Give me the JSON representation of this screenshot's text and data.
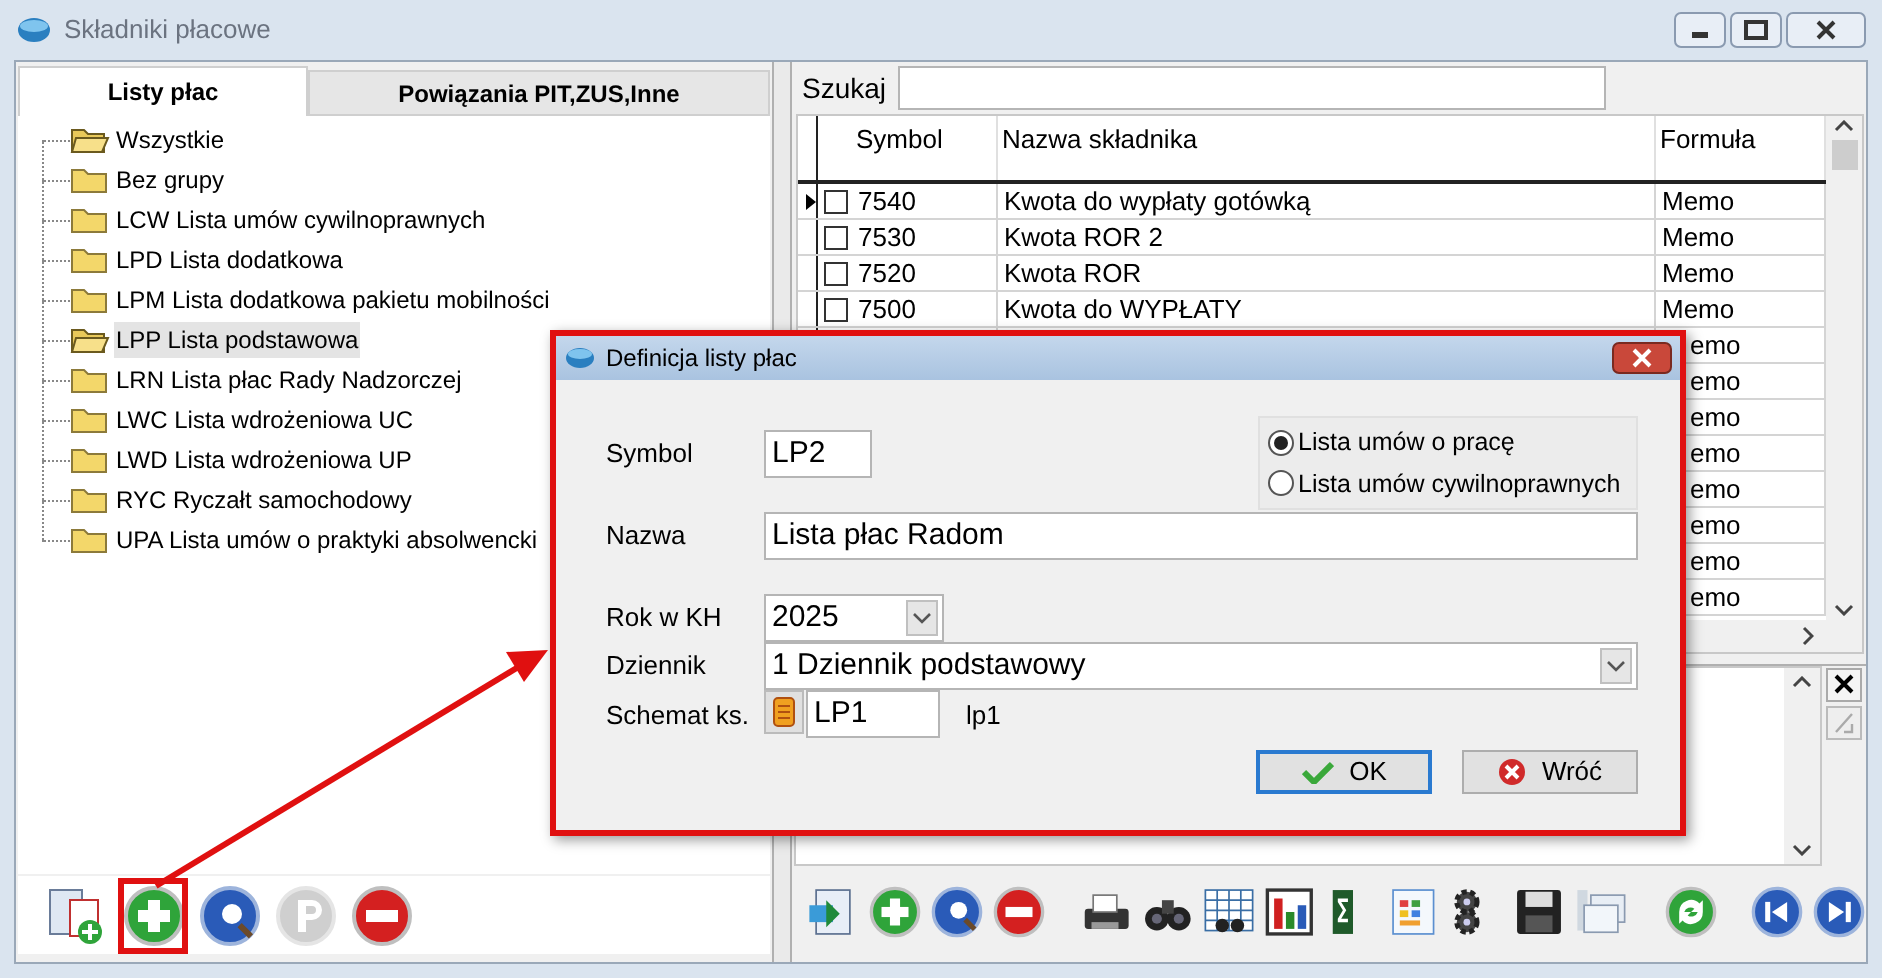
{
  "window": {
    "title": "Składniki płacowe"
  },
  "tabs": [
    {
      "label": "Listy płac",
      "selected": true
    },
    {
      "label": "Powiązania PIT,ZUS,Inne",
      "selected": false
    }
  ],
  "tree": {
    "items": [
      {
        "label": "Wszystkie",
        "open": true,
        "selected": false
      },
      {
        "label": "Bez grupy",
        "open": false,
        "selected": false
      },
      {
        "label": "LCW Lista umów cywilnoprawnych",
        "open": false,
        "selected": false
      },
      {
        "label": "LPD Lista dodatkowa",
        "open": false,
        "selected": false
      },
      {
        "label": "LPM Lista dodatkowa pakietu mobilności",
        "open": false,
        "selected": false
      },
      {
        "label": "LPP Lista podstawowa",
        "open": true,
        "selected": true
      },
      {
        "label": "LRN Lista płac Rady Nadzorczej",
        "open": false,
        "selected": false
      },
      {
        "label": "LWC Lista wdrożeniowa UC",
        "open": false,
        "selected": false
      },
      {
        "label": "LWD Lista wdrożeniowa UP",
        "open": false,
        "selected": false
      },
      {
        "label": "RYC Ryczałt samochodowy",
        "open": false,
        "selected": false
      },
      {
        "label": "UPA Lista umów o praktyki absolwencki",
        "open": false,
        "selected": false
      }
    ]
  },
  "left_toolbar": [
    {
      "kind": "add-list",
      "highlighted": false
    },
    {
      "kind": "add",
      "highlighted": true
    },
    {
      "kind": "preview",
      "highlighted": false
    },
    {
      "kind": "p",
      "highlighted": false
    },
    {
      "kind": "remove",
      "highlighted": false
    }
  ],
  "search": {
    "label": "Szukaj"
  },
  "grid": {
    "columns": [
      "Symbol",
      "Nazwa składnika",
      "Formuła"
    ],
    "rows": [
      {
        "symbol": "7540",
        "name": "Kwota do wypłaty gotówką",
        "formula": "Memo",
        "current": true,
        "checked": false
      },
      {
        "symbol": "7530",
        "name": "Kwota ROR 2",
        "formula": "Memo",
        "current": false,
        "checked": false
      },
      {
        "symbol": "7520",
        "name": "Kwota ROR",
        "formula": "Memo",
        "current": false,
        "checked": false
      },
      {
        "symbol": "7500",
        "name": "Kwota do WYPŁATY",
        "formula": "Memo",
        "current": false,
        "checked": false
      },
      {
        "formula": "emo"
      },
      {
        "formula": "emo"
      },
      {
        "formula": "emo"
      },
      {
        "formula": "emo"
      },
      {
        "formula": "emo"
      },
      {
        "formula": "emo"
      },
      {
        "formula": "emo"
      },
      {
        "formula": "emo"
      }
    ]
  },
  "right_toolbar": [
    {
      "kind": "export"
    },
    {
      "kind": "add"
    },
    {
      "kind": "preview"
    },
    {
      "kind": "remove"
    },
    {
      "kind": "print"
    },
    {
      "kind": "binoculars"
    },
    {
      "kind": "grid-search"
    },
    {
      "kind": "chart"
    },
    {
      "kind": "sum"
    },
    {
      "kind": "sheet"
    },
    {
      "kind": "gear"
    },
    {
      "kind": "save"
    },
    {
      "kind": "windows"
    },
    {
      "kind": "refresh"
    },
    {
      "kind": "first"
    },
    {
      "kind": "last"
    }
  ],
  "dialog": {
    "title": "Definicja listy płac",
    "symbol": {
      "label": "Symbol",
      "value": "LP2"
    },
    "radios": [
      {
        "label": "Lista umów o pracę",
        "selected": true
      },
      {
        "label": "Lista umów cywilnoprawnych",
        "selected": false
      }
    ],
    "name": {
      "label": "Nazwa",
      "value": "Lista płac Radom"
    },
    "year": {
      "label": "Rok w KH",
      "value": "2025"
    },
    "journal": {
      "label": "Dziennik",
      "value": "1  Dziennik podstawowy"
    },
    "scheme": {
      "label": "Schemat ks.",
      "value": "LP1",
      "description": "lp1"
    },
    "buttons": [
      {
        "kind": "ok",
        "label": "OK",
        "focused": true
      },
      {
        "kind": "back",
        "label": "Wróć",
        "focused": false
      }
    ]
  }
}
